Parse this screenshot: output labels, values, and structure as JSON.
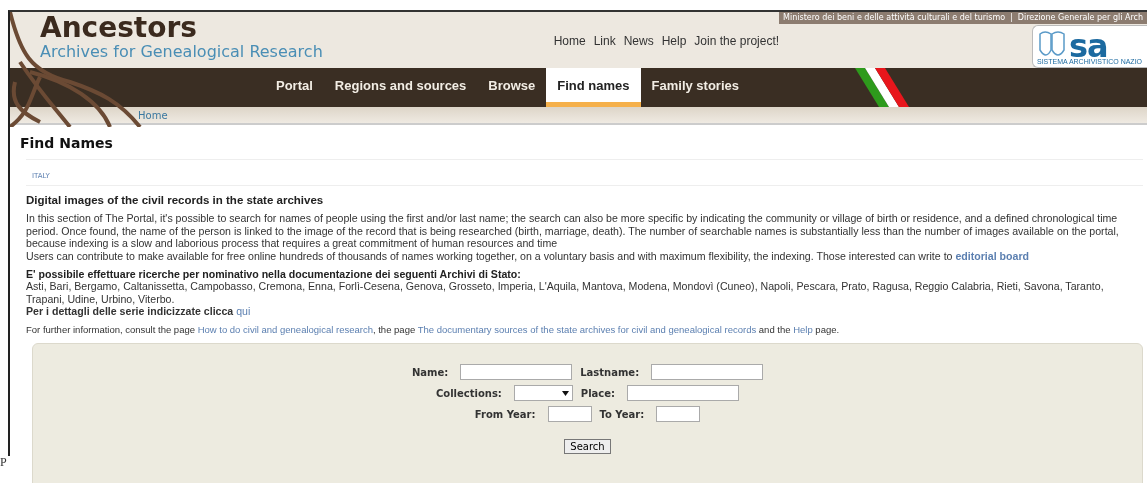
{
  "header": {
    "title": "Ancestors",
    "subtitle": "Archives for Genealogical Research",
    "ministry_links": [
      "Ministero dei beni e delle attività culturali e del turismo",
      "Direzione Generale per gli Arch"
    ],
    "ministry_separator": "|",
    "top_links": [
      "Home",
      "Link",
      "News",
      "Help",
      "Join the project!"
    ],
    "logo_text": "sa",
    "logo_caption": "SISTEMA ARCHIVISTICO NAZIO"
  },
  "nav": [
    {
      "label": "Portal",
      "selected": false
    },
    {
      "label": "Regions and sources",
      "selected": false
    },
    {
      "label": "Browse",
      "selected": false
    },
    {
      "label": "Find names",
      "selected": true
    },
    {
      "label": "Family stories",
      "selected": false
    }
  ],
  "breadcrumb": [
    "Home"
  ],
  "page_title": "Find Names",
  "tab_label": "ITALY",
  "section_title": "Digital images of the civil records in the state archives",
  "intro": [
    [
      {
        "kind": "text",
        "text": "In this section of The Portal, it's possible to search for names of people using the first and/or last name; the search can also be more specific by indicating the community or village of birth or residence, and a defined chronological time period. Once found, the name of the person is linked to the image of the record that is being researched (birth, marriage, death). The number of searchable names is substantially less than the number of images available on the portal, because indexing is a slow and laborious process that requires a great commitment of human resources and time"
      }
    ],
    [
      {
        "kind": "text",
        "text": "Users can contribute to make available for free online hundreds of thousands of names working together, on a voluntary basis and with maximum flexibility, the indexing. Those interested can write to"
      },
      {
        "kind": "bold-link",
        "text": "editorial board"
      }
    ]
  ],
  "archives": {
    "heading": "E' possibile effettuare ricerche per nominativo nella documentazione dei seguenti Archivi di Stato:",
    "list": "Asti, Bari, Bergamo, Caltanissetta, Campobasso, Cremona, Enna, Forlì-Cesena, Genova, Grosseto, Imperia, L'Aquila, Mantova, Modena, Mondovì (Cuneo), Napoli, Pescara, Prato, Ragusa, Reggio Calabria, Rieti, Savona, Taranto, Trapani, Udine, Urbino, Viterbo.",
    "details_text": "Per i dettagli delle serie indicizzate clicca",
    "details_link": "qui"
  },
  "further_info": [
    {
      "kind": "text",
      "text": "For further information, consult the page"
    },
    {
      "kind": "link",
      "text": "How to do civil and genealogical research"
    },
    {
      "kind": "text",
      "text": ", the page"
    },
    {
      "kind": "link",
      "text": "The documentary sources of the state archives for civil and genealogical records"
    },
    {
      "kind": "text",
      "text": "and the"
    },
    {
      "kind": "link",
      "text": "Help"
    },
    {
      "kind": "text",
      "text": "page."
    }
  ],
  "form": {
    "rows": [
      [
        {
          "label": "Name:",
          "kind": "text"
        },
        {
          "label": "Lastname:",
          "kind": "text"
        }
      ],
      [
        {
          "label": "Collections:",
          "kind": "select"
        },
        {
          "label": "Place:",
          "kind": "text"
        }
      ],
      [
        {
          "label": "From Year:",
          "kind": "year"
        },
        {
          "label": "To Year:",
          "kind": "year"
        }
      ]
    ],
    "button": "Search"
  },
  "stray_text": "P"
}
